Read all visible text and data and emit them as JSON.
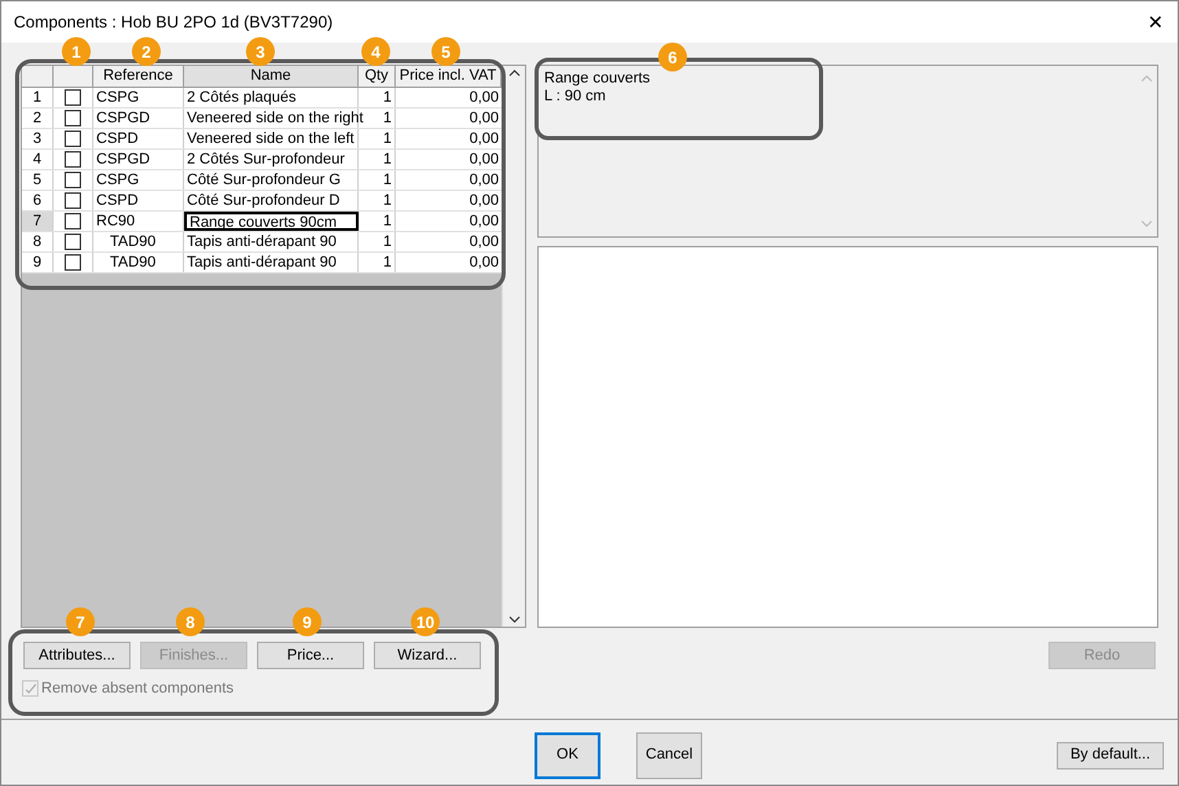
{
  "window": {
    "title": "Components : Hob BU 2PO 1d (BV3T7290)",
    "close": "✕"
  },
  "table": {
    "columns": [
      "Reference",
      "Name",
      "Qty",
      "Price incl. VAT"
    ],
    "rows": [
      {
        "number": "1",
        "checked": false,
        "selected": false,
        "reference": "CSPG",
        "name": "2 Côtés plaqués",
        "qty": "1",
        "price": "0,00"
      },
      {
        "number": "2",
        "checked": false,
        "selected": false,
        "reference": "CSPGD",
        "name": "Veneered side on the right",
        "qty": "1",
        "price": "0,00"
      },
      {
        "number": "3",
        "checked": false,
        "selected": false,
        "reference": "CSPD",
        "name": "Veneered side on the left",
        "qty": "1",
        "price": "0,00"
      },
      {
        "number": "4",
        "checked": false,
        "selected": false,
        "reference": "CSPGD",
        "name": "2 Côtés Sur-profondeur",
        "qty": "1",
        "price": "0,00"
      },
      {
        "number": "5",
        "checked": false,
        "selected": false,
        "reference": "CSPG",
        "name": "Côté Sur-profondeur G",
        "qty": "1",
        "price": "0,00"
      },
      {
        "number": "6",
        "checked": false,
        "selected": false,
        "reference": "CSPD",
        "name": "Côté Sur-profondeur D",
        "qty": "1",
        "price": "0,00"
      },
      {
        "number": "7",
        "checked": false,
        "selected": true,
        "reference": "RC90",
        "name": "Range couverts 90cm",
        "qty": "1",
        "price": "0,00",
        "children": [
          {
            "number": "8",
            "checked": false,
            "selected": false,
            "reference": "TAD90",
            "name": "Tapis anti-dérapant 90",
            "qty": "1",
            "price": "0,00"
          },
          {
            "number": "9",
            "checked": false,
            "selected": false,
            "reference": "TAD90",
            "name": "Tapis anti-dérapant 90",
            "qty": "1",
            "price": "0,00"
          }
        ]
      }
    ]
  },
  "description": [
    "Range couverts",
    "L : 90 cm"
  ],
  "buttons": [
    {
      "label": "Attributes...",
      "disabled": false
    },
    {
      "label": "Finishes...",
      "disabled": true
    },
    {
      "label": "Price...",
      "disabled": false
    },
    {
      "label": "Wizard...",
      "disabled": false
    }
  ],
  "remove_absent": {
    "label": "Remove absent components",
    "checked": true,
    "disabled": true
  },
  "redo": {
    "label": "Redo",
    "disabled": true
  },
  "footer": [
    {
      "label": "OK",
      "default": true
    },
    {
      "label": "Cancel",
      "default": false
    }
  ],
  "by_default": {
    "label": "By default..."
  },
  "callouts": [
    "1",
    "2",
    "3",
    "4",
    "5",
    "6",
    "7",
    "8",
    "9",
    "10"
  ]
}
